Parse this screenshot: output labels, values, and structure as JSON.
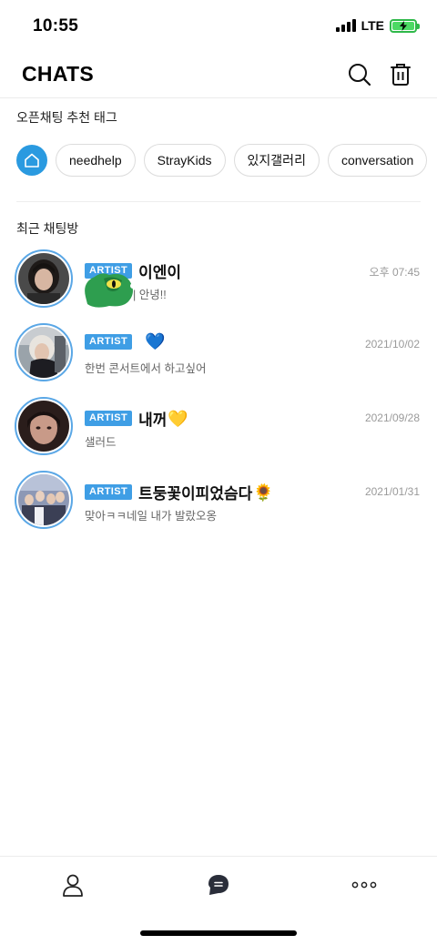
{
  "status_bar": {
    "time": "10:55",
    "network": "LTE",
    "battery_icon": "battery-charging-icon",
    "signal_icon": "signal-bars-icon"
  },
  "header": {
    "title": "CHATS",
    "search_icon": "search-icon",
    "delete_icon": "trash-icon"
  },
  "open_chat_tags": {
    "label": "오픈채팅 추천 태그",
    "home_icon": "home-icon",
    "tags": [
      "needhelp",
      "StrayKids",
      "있지갤러리",
      "conversation"
    ]
  },
  "recent_chats": {
    "label": "최근 채팅방",
    "items": [
      {
        "badge": "ARTIST",
        "name": "이엔이",
        "emoji": "",
        "preview": "| 안녕!!",
        "time": "오후 07:45"
      },
      {
        "badge": "ARTIST",
        "name": "",
        "emoji": "💙",
        "preview": "한번 콘서트에서 하고싶어",
        "time": "2021/10/02"
      },
      {
        "badge": "ARTIST",
        "name": "내꺼",
        "emoji": "💛",
        "preview": "샐러드",
        "time": "2021/09/28"
      },
      {
        "badge": "ARTIST",
        "name": "트둥꽃이피었슴다",
        "emoji": "🌻",
        "preview": "맞아ㅋㅋ네일 내가 발랐오옹",
        "time": "2021/01/31"
      }
    ]
  },
  "bottom_nav": {
    "items": [
      "profile-icon",
      "chat-bubble-icon",
      "more-dots-icon"
    ]
  },
  "colors": {
    "accent": "#3f9ee5",
    "home_tag": "#2a9ae0",
    "avatar_ring": "#5aa7e6",
    "sticker": "#2e9e4f"
  }
}
